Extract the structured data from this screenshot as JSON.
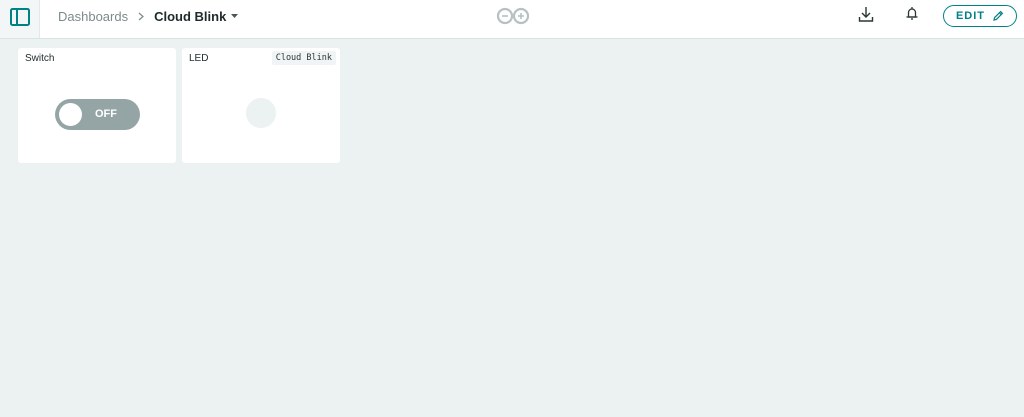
{
  "header": {
    "breadcrumb": {
      "parent": "Dashboards",
      "current": "Cloud Blink"
    },
    "actions": {
      "edit_label": "EDIT"
    }
  },
  "icons": [
    "sidebar-panel-icon",
    "chevron-right-icon",
    "caret-down-icon",
    "arduino-logo-icon",
    "download-icon",
    "bell-icon",
    "pencil-icon"
  ],
  "colors": {
    "accent": "#008184",
    "background": "#ecf1f1",
    "switch_off": "#95a5a6"
  },
  "widgets": [
    {
      "title": "Switch",
      "type": "switch",
      "state_label": "OFF",
      "value": false
    },
    {
      "title": "LED",
      "type": "led",
      "thing_tag": "Cloud Blink",
      "value": false
    }
  ]
}
